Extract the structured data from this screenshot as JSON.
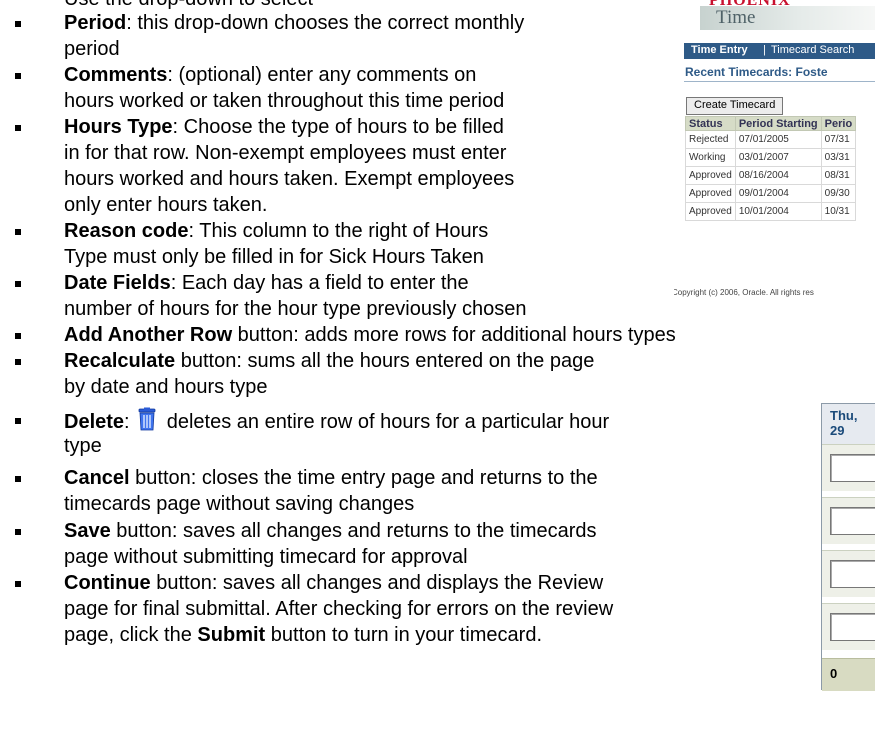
{
  "bullets": [
    {
      "lines": [
        [
          "",
          "Use the drop-down to select"
        ],
        [
          "",
          ""
        ]
      ],
      "partial_top": true
    },
    {
      "lines": [
        [
          "Period",
          ": this drop-down chooses the correct monthly"
        ],
        [
          "",
          "period"
        ]
      ]
    },
    {
      "lines": [
        [
          "Comments",
          ": (optional) enter any comments on"
        ],
        [
          "",
          "hours worked or taken throughout this time period"
        ]
      ]
    },
    {
      "lines": [
        [
          "Hours Type",
          ": Choose the type of hours to be filled"
        ],
        [
          "",
          "in for that row.  Non-exempt employees must enter"
        ],
        [
          "",
          "hours worked and hours taken.  Exempt employees"
        ],
        [
          "",
          "only enter hours taken."
        ]
      ]
    },
    {
      "lines": [
        [
          "Reason code",
          ": This column to the right of Hours"
        ],
        [
          "",
          "Type must only be filled in for Sick Hours Taken"
        ]
      ]
    },
    {
      "lines": [
        [
          "Date Fields",
          ": Each day has a field to enter the"
        ],
        [
          "",
          "number of hours for the hour type previously chosen"
        ]
      ]
    },
    {
      "lines": [
        [
          "Add Another Row",
          " button: adds more rows for additional hours types"
        ]
      ]
    },
    {
      "lines": [
        [
          "Recalculate",
          " button: sums all the hours entered on the page"
        ],
        [
          "",
          "by date and hours type"
        ]
      ]
    },
    {
      "lines": [
        [
          "Delete",
          ": "
        ],
        [
          "",
          "type"
        ]
      ],
      "icon_after_label": "trash-icon",
      "icon_suffix": " deletes an entire row of hours for a particular hour"
    },
    {
      "lines": [
        [
          "Cancel",
          " button: closes the time entry page and returns to the"
        ],
        [
          "",
          "timecards page without saving changes"
        ]
      ]
    },
    {
      "lines": [
        [
          "Save",
          " button: saves all changes and returns to the timecards"
        ],
        [
          "",
          "page without submitting timecard for approval"
        ]
      ]
    },
    {
      "lines": [
        [
          "Continue",
          " button: saves all changes and displays the Review"
        ],
        [
          "",
          "page for final submittal.  After checking for errors on the review"
        ],
        [
          "",
          "page, click the "
        ]
      ],
      "last_bold": "Submit",
      "last_tail": " button to turn in your timecard."
    }
  ],
  "screenshot": {
    "brand": "PHOENIX",
    "app_title": "Time",
    "tab_active": "Time Entry",
    "tab_separator": "|",
    "tab_search": "Timecard Search",
    "recent_title": "Recent Timecards: Foste",
    "create_button": "Create Timecard",
    "columns": [
      "Status",
      "Period Starting",
      "Perio"
    ],
    "rows": [
      [
        "Rejected",
        "07/01/2005",
        "07/31"
      ],
      [
        "Working",
        "03/01/2007",
        "03/31"
      ],
      [
        "Approved",
        "08/16/2004",
        "08/31"
      ],
      [
        "Approved",
        "09/01/2004",
        "09/30"
      ],
      [
        "Approved",
        "10/01/2004",
        "10/31"
      ]
    ],
    "copyright": "Copyright (c) 2006, Oracle. All rights res"
  },
  "date_column": {
    "header": "Thu, 29",
    "total": "0"
  },
  "colors": {
    "brand_red": "#c8102e",
    "tab_blue": "#2e5a87",
    "header_green": "#d6dcc7"
  }
}
